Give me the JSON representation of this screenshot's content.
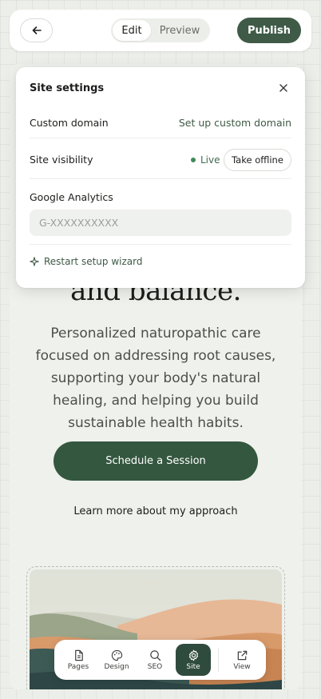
{
  "topbar": {
    "back_icon": "arrow-left-icon",
    "mode_tabs": [
      {
        "label": "Edit",
        "active": true
      },
      {
        "label": "Preview",
        "active": false
      }
    ],
    "publish_label": "Publish"
  },
  "site": {
    "heading_fragment": "and balance.",
    "body": "Personalized naturopathic care focused on addressing root causes, supporting your body's natural healing, and helping you build sustainable health habits.",
    "cta_label": "Schedule a Session",
    "secondary_link": "Learn more about my approach"
  },
  "settings": {
    "title": "Site settings",
    "close_icon": "close-icon",
    "custom_domain_label": "Custom domain",
    "custom_domain_action": "Set up custom domain",
    "visibility_label": "Site visibility",
    "visibility_status": "Live",
    "visibility_action": "Take offline",
    "analytics_label": "Google Analytics",
    "analytics_value": "",
    "analytics_placeholder": "G-XXXXXXXXXX",
    "wizard_label": "Restart setup wizard",
    "wizard_icon": "sparkle-icon"
  },
  "dock": {
    "items": [
      {
        "label": "Pages",
        "icon": "file-icon",
        "active": false
      },
      {
        "label": "Design",
        "icon": "palette-icon",
        "active": false
      },
      {
        "label": "SEO",
        "icon": "search-icon",
        "active": false
      },
      {
        "label": "Site",
        "icon": "gear-icon",
        "active": true
      },
      {
        "label": "View",
        "icon": "external-link-icon",
        "active": false
      }
    ]
  },
  "colors": {
    "brand_green": "#3f5a46",
    "cta_green": "#34573f",
    "live_green": "#3f8a55",
    "canvas_bg": "#eef1ec"
  }
}
